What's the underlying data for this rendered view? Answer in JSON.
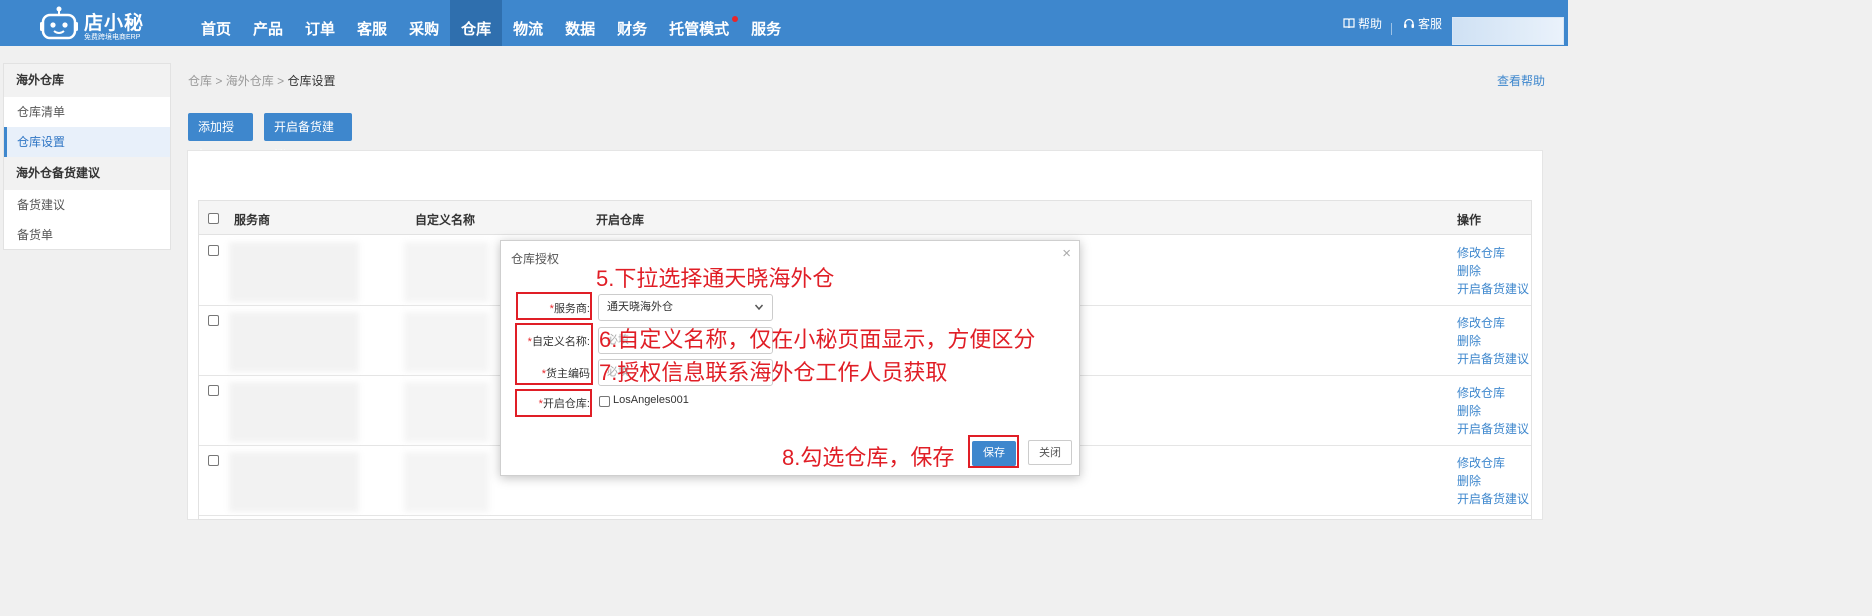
{
  "brand": {
    "name": "店小秘",
    "subtitle": "免费跨境电商ERP"
  },
  "nav": {
    "items": [
      {
        "label": "首页"
      },
      {
        "label": "产品"
      },
      {
        "label": "订单"
      },
      {
        "label": "客服"
      },
      {
        "label": "采购"
      },
      {
        "label": "仓库"
      },
      {
        "label": "物流"
      },
      {
        "label": "数据"
      },
      {
        "label": "财务"
      },
      {
        "label": "托管模式"
      },
      {
        "label": "服务"
      }
    ],
    "help": "帮助",
    "service": "客服"
  },
  "sidebar": {
    "groups": [
      {
        "title": "海外仓库",
        "items": [
          {
            "label": "仓库清单"
          },
          {
            "label": "仓库设置"
          }
        ]
      },
      {
        "title": "海外仓备货建议",
        "items": [
          {
            "label": "备货建议"
          },
          {
            "label": "备货单"
          }
        ]
      }
    ]
  },
  "breadcrumb": {
    "a": "仓库",
    "b": "海外仓库",
    "current": "仓库设置",
    "sep": ">"
  },
  "view_help": "查看帮助",
  "toolbar": {
    "add_auth": "添加授权",
    "enable_stock": "开启备货建议"
  },
  "table": {
    "headers": {
      "provider": "服务商",
      "custom_name": "自定义名称",
      "enabled_wh": "开启仓库",
      "ops": "操作"
    },
    "row_actions": {
      "edit": "修改仓库",
      "delete": "删除",
      "enable": "开启备货建议"
    }
  },
  "modal": {
    "title": "仓库授权",
    "close": "×",
    "required_mark": "*",
    "provider_label": "服务商:",
    "provider_value": "通天晓海外仓",
    "custom_name_label": "自定义名称:",
    "custom_name_placeholder": "必填",
    "owner_code_label": "货主编码",
    "owner_code_placeholder": "必填",
    "warehouse_label": "开启仓库:",
    "warehouse_option": "LosAngeles001",
    "save": "保存",
    "close_btn": "关闭"
  },
  "annotations": {
    "step5": "5.下拉选择通天晓海外仓",
    "step6": "6.自定义名称，仅在小秘页面显示，方便区分",
    "step7": "7.授权信息联系海外仓工作人员获取",
    "step8": "8.勾选仓库，保存"
  },
  "colors": {
    "brand_blue": "#3e87cd",
    "annotation_red": "#e01e26"
  }
}
